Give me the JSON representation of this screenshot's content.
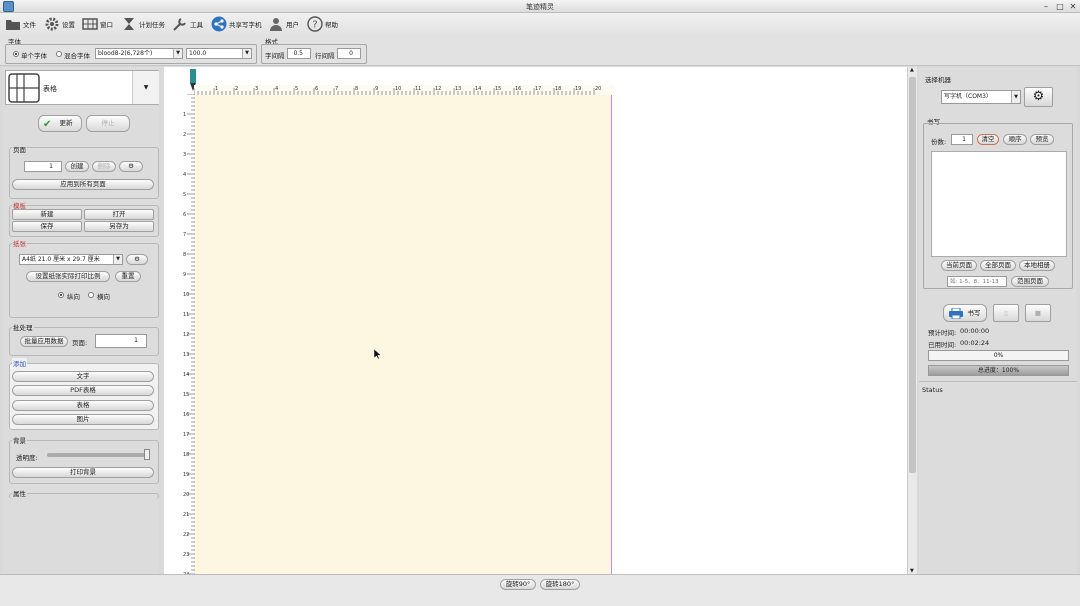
{
  "window": {
    "title": "笔迹精灵"
  },
  "toolbar": {
    "file": "文件",
    "settings": "设置",
    "window": "窗口",
    "plan": "计划任务",
    "tools": "工具",
    "share": "共享写字机",
    "user": "用户",
    "help": "帮助"
  },
  "font_group": {
    "label": "字体",
    "single": "单个字体",
    "mixed": "混合字体",
    "font_value": "blood8-2(6,728个)",
    "size_value": "100.0"
  },
  "format_group": {
    "label": "格式",
    "char_spacing_label": "字间隔",
    "char_spacing_value": "0.5",
    "line_spacing_label": "行间隔",
    "line_spacing_value": "0"
  },
  "left": {
    "template_label": "表格",
    "update": "更新",
    "stop": "停止",
    "page_section": "页面",
    "page_value": "1",
    "new": "创建",
    "delete": "删除",
    "apply_all": "应用到所有页面",
    "template_section": "模板",
    "tpl_new": "新建",
    "tpl_open": "打开",
    "tpl_save": "保存",
    "tpl_saveas": "另存为",
    "paper_section": "纸张",
    "paper_value": "A4纸 21.0 厘米 x 29.7 厘米",
    "set_ratio": "设置纸张实际打印比例",
    "reset": "重置",
    "portrait": "纵向",
    "landscape": "横向",
    "batch_section": "批处理",
    "batch_apply": "批量应用数据",
    "page_label": "页面:",
    "batch_page": "1",
    "add_section": "添加",
    "add_text": "文字",
    "add_pdf": "PDF表格",
    "add_table": "表格",
    "add_image": "图片",
    "bg_section": "背景",
    "transparency": "透明度:",
    "print_bg": "打印背景",
    "props_section": "属性"
  },
  "right": {
    "select_machine": "选择机器",
    "machine_value": "写字机（COM3）",
    "write_section": "书写",
    "copies_label": "份数:",
    "copies_value": "1",
    "clear": "清空",
    "order": "顺序",
    "preview": "预览",
    "current_page": "当前页面",
    "all_pages": "全部页面",
    "local_album": "本地相册",
    "range_placeholder": "如: 1-5、8、11-13",
    "range_page": "范围页面",
    "write": "书写",
    "est_time_label": "预计时间:",
    "est_time": "00:00:00",
    "used_time_label": "已用时间:",
    "used_time": "00:02:24",
    "progress": "0%",
    "total_progress": "总进度：100%",
    "status": "Status"
  },
  "bottom": {
    "rotate90": "旋转90°",
    "rotate180": "旋转180°"
  },
  "ruler_h": [
    "1",
    "2",
    "3",
    "4",
    "5",
    "6",
    "7",
    "8",
    "9",
    "10",
    "11",
    "12",
    "13",
    "14",
    "15",
    "16",
    "17",
    "18",
    "19",
    "20"
  ],
  "ruler_v": [
    "1",
    "2",
    "3",
    "4",
    "5",
    "6",
    "7",
    "8",
    "9",
    "10",
    "11",
    "12",
    "13",
    "14",
    "15",
    "16",
    "17",
    "18",
    "19",
    "20",
    "21",
    "22",
    "23",
    "24"
  ],
  "colors": {
    "paper": "#fdf6e1",
    "accent": "#2f73c2",
    "section_red": "#c0392b",
    "section_blue": "#2f4fc2"
  }
}
